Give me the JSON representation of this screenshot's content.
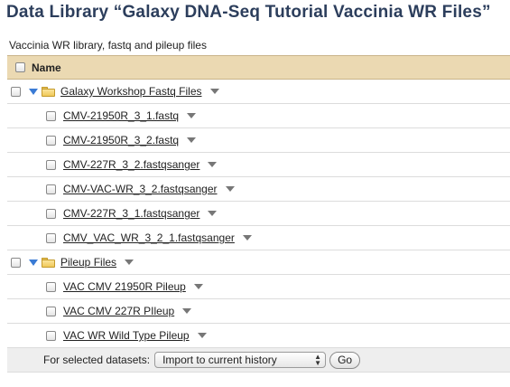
{
  "page": {
    "title": "Data Library “Galaxy DNA-Seq Tutorial Vaccinia WR Files”",
    "description": "Vaccinia WR library, fastq and pileup files"
  },
  "table": {
    "header_label": "Name",
    "folders": [
      {
        "name": "Galaxy Workshop Fastq Files",
        "files": [
          "CMV-21950R_3_1.fastq",
          "CMV-21950R_3_2.fastq",
          "CMV-227R_3_2.fastqsanger",
          "CMV-VAC-WR_3_2.fastqsanger",
          "CMV-227R_3_1.fastqsanger",
          "CMV_VAC_WR_3_2_1.fastqsanger"
        ]
      },
      {
        "name": "Pileup Files",
        "files": [
          "VAC CMV 21950R Pileup",
          "VAC CMV 227R PIleup",
          "VAC WR Wild Type Pileup"
        ]
      }
    ]
  },
  "footer": {
    "label": "For selected datasets:",
    "action_selected": "Import to current history",
    "go_label": "Go"
  },
  "colors": {
    "title": "#2c3e5c",
    "header_bg": "#ebd9b2",
    "expander": "#3a7bd5",
    "folder": "#f0c95a"
  },
  "icons": {
    "expander": "triangle-down-icon",
    "folder": "folder-icon",
    "dropdown": "chevron-down-icon"
  }
}
